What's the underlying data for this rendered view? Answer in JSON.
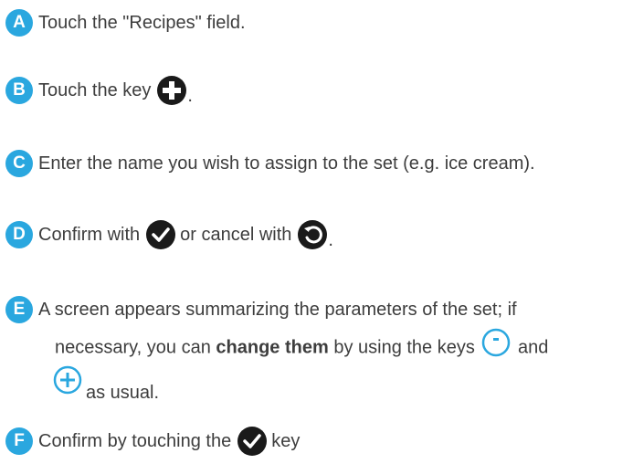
{
  "steps": {
    "a": {
      "letter": "A",
      "text": "Touch the \"Recipes\" field."
    },
    "b": {
      "letter": "B",
      "before": "Touch the key",
      "after": "."
    },
    "c": {
      "letter": "C",
      "text": "Enter the name you wish to assign to the set (e.g. ice cream)."
    },
    "d": {
      "letter": "D",
      "before": "Confirm with",
      "middle": "or cancel with",
      "after": "."
    },
    "e": {
      "letter": "E",
      "line1": "A screen appears summarizing the parameters of the set; if",
      "line2_before": "necessary, you can",
      "line2_bold": "change them",
      "line2_after": "by using the keys",
      "line2_end": "and",
      "line3": "as usual."
    },
    "f": {
      "letter": "F",
      "before": "Confirm by touching the",
      "after": "key"
    }
  },
  "colors": {
    "accent": "#2aa7df",
    "icon_dark": "#1a1a1a"
  },
  "icons": [
    "plus-circle-icon",
    "check-circle-icon",
    "back-circle-icon",
    "minus-outline-icon",
    "plus-outline-icon"
  ]
}
